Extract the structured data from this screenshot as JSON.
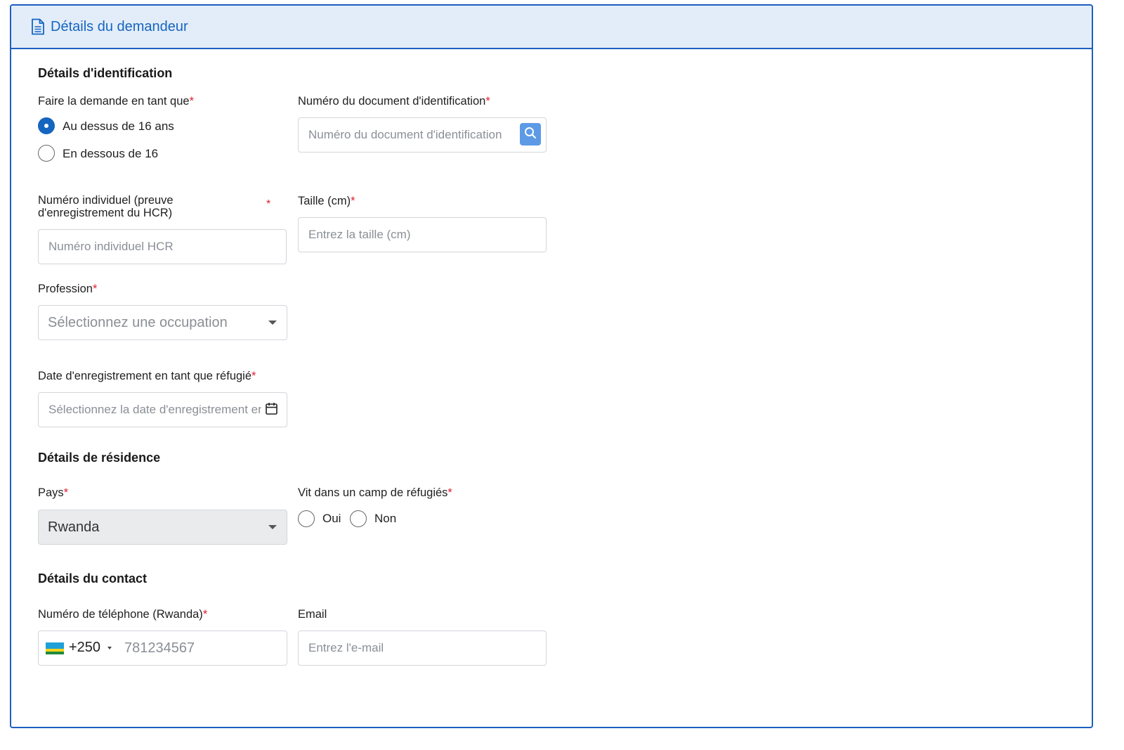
{
  "header": {
    "title": "Détails du demandeur",
    "icon": "document-icon"
  },
  "identification": {
    "title": "Détails d'identification",
    "apply_as": {
      "label": "Faire la demande en tant que",
      "options": [
        {
          "label": "Au dessus de 16 ans",
          "checked": true
        },
        {
          "label": "En dessous de 16",
          "checked": false
        }
      ]
    },
    "id_document": {
      "label": "Numéro du document d'identification",
      "placeholder": "Numéro du document d'identification"
    },
    "hcr_number": {
      "label_line1": "Numéro individuel (preuve",
      "label_line2": "d'enregistrement du HCR)",
      "placeholder": "Numéro individuel HCR"
    },
    "height": {
      "label": "Taille (cm)",
      "placeholder": "Entrez la taille (cm)"
    },
    "profession": {
      "label": "Profession",
      "placeholder": "Sélectionnez une occupation"
    },
    "registration_date": {
      "label": "Date d'enregistrement en tant que réfugié",
      "placeholder": "Sélectionnez la date d'enregistrement en tant que réfugié"
    }
  },
  "residence": {
    "title": "Détails de résidence",
    "country": {
      "label": "Pays",
      "value": "Rwanda"
    },
    "refugee_camp": {
      "label": "Vit dans un camp de réfugiés",
      "options": [
        {
          "label": "Oui",
          "checked": false
        },
        {
          "label": "Non",
          "checked": false
        }
      ]
    }
  },
  "contact": {
    "title": "Détails du contact",
    "phone": {
      "label": "Numéro de téléphone (Rwanda)",
      "dial_code": "+250",
      "placeholder": "781234567"
    },
    "email": {
      "label": "Email",
      "placeholder": "Entrez l'e-mail"
    }
  },
  "required_marker": "*",
  "colors": {
    "accent": "#1565c0",
    "header_bg": "#e3edf9",
    "required": "#e0202e",
    "search_button": "#5c9ae6"
  }
}
